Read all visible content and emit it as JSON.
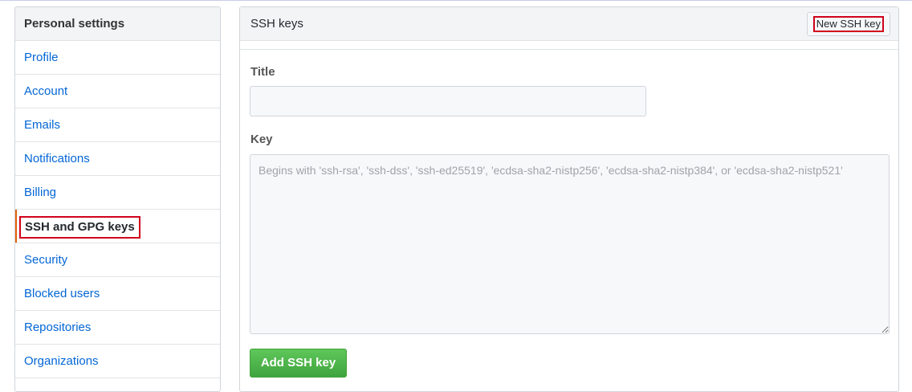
{
  "sidebar": {
    "header": "Personal settings",
    "items": [
      {
        "label": "Profile"
      },
      {
        "label": "Account"
      },
      {
        "label": "Emails"
      },
      {
        "label": "Notifications"
      },
      {
        "label": "Billing"
      },
      {
        "label": "SSH and GPG keys",
        "selected": true
      },
      {
        "label": "Security"
      },
      {
        "label": "Blocked users"
      },
      {
        "label": "Repositories"
      },
      {
        "label": "Organizations"
      }
    ]
  },
  "panel": {
    "title": "SSH keys",
    "new_key_button": "New SSH key",
    "form": {
      "title_label": "Title",
      "title_value": "",
      "key_label": "Key",
      "key_placeholder": "Begins with 'ssh-rsa', 'ssh-dss', 'ssh-ed25519', 'ecdsa-sha2-nistp256', 'ecdsa-sha2-nistp384', or 'ecdsa-sha2-nistp521'",
      "key_value": "",
      "submit_label": "Add SSH key"
    }
  },
  "colors": {
    "link": "#0366d6",
    "selected_accent": "#e36209",
    "highlight_box": "#d0021b",
    "primary_button": "#3fa33e"
  }
}
